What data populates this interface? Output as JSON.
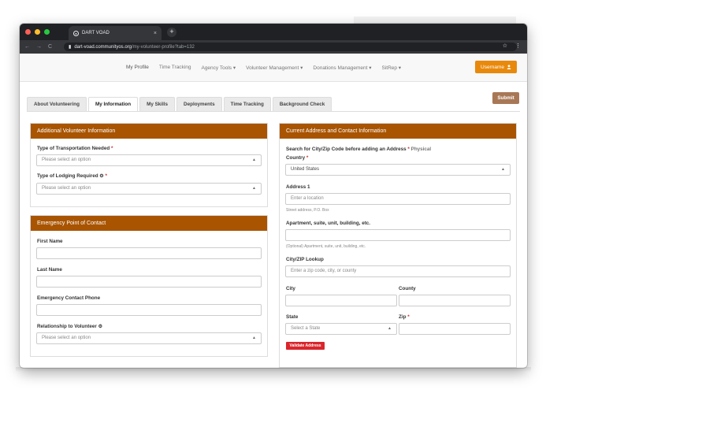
{
  "browser": {
    "tab_title": "DART VOAD",
    "tab_close": "×",
    "new_tab": "+",
    "url_host": "dart-voad.communityos.org",
    "url_path": "/my-volunteer-profile?tab=132",
    "back": "←",
    "forward": "→",
    "reload": "C",
    "star": "☆",
    "menu": "⋮"
  },
  "nav": {
    "links": [
      "My Profile",
      "Time Tracking",
      "Agency Tools ▾",
      "Volunteer Management ▾",
      "Donations Management ▾",
      "SitRep ▾"
    ],
    "user_label": "Username"
  },
  "tabs": [
    "About Volunteering",
    "My Information",
    "My Skills",
    "Deployments",
    "Time Tracking",
    "Background Check"
  ],
  "submit_label": "Submit",
  "additional": {
    "title": "Additional Volunteer Information",
    "transport_label": "Type of Transportation Needed",
    "transport_placeholder": "Please select an option",
    "lodging_label": "Type of Lodging Required",
    "lodging_placeholder": "Please select an option"
  },
  "emergency": {
    "title": "Emergency Point of Contact",
    "first_name": "First Name",
    "last_name": "Last Name",
    "phone": "Emergency Contact Phone",
    "relationship": "Relationship to Volunteer",
    "relationship_placeholder": "Please select an option"
  },
  "address": {
    "title": "Current Address and Contact Information",
    "search_note": "Search for City/Zip Code before adding an Address",
    "physical": "Physical",
    "country_label": "Country",
    "country_value": "United States",
    "address1_label": "Address 1",
    "address1_placeholder": "Enter a location",
    "address1_help": "Street address, P.O. Box",
    "apt_label": "Apartment, suite, unit, building, etc.",
    "apt_help": "(Optional) Apartment, suite, unit, building, etc.",
    "lookup_label": "City/ZIP Lookup",
    "lookup_placeholder": "Enter a zip code, city, or county",
    "city_label": "City",
    "county_label": "County",
    "state_label": "State",
    "state_placeholder": "Select a State",
    "zip_label": "Zip",
    "validate_label": "Validate Address"
  },
  "required_mark": "*"
}
